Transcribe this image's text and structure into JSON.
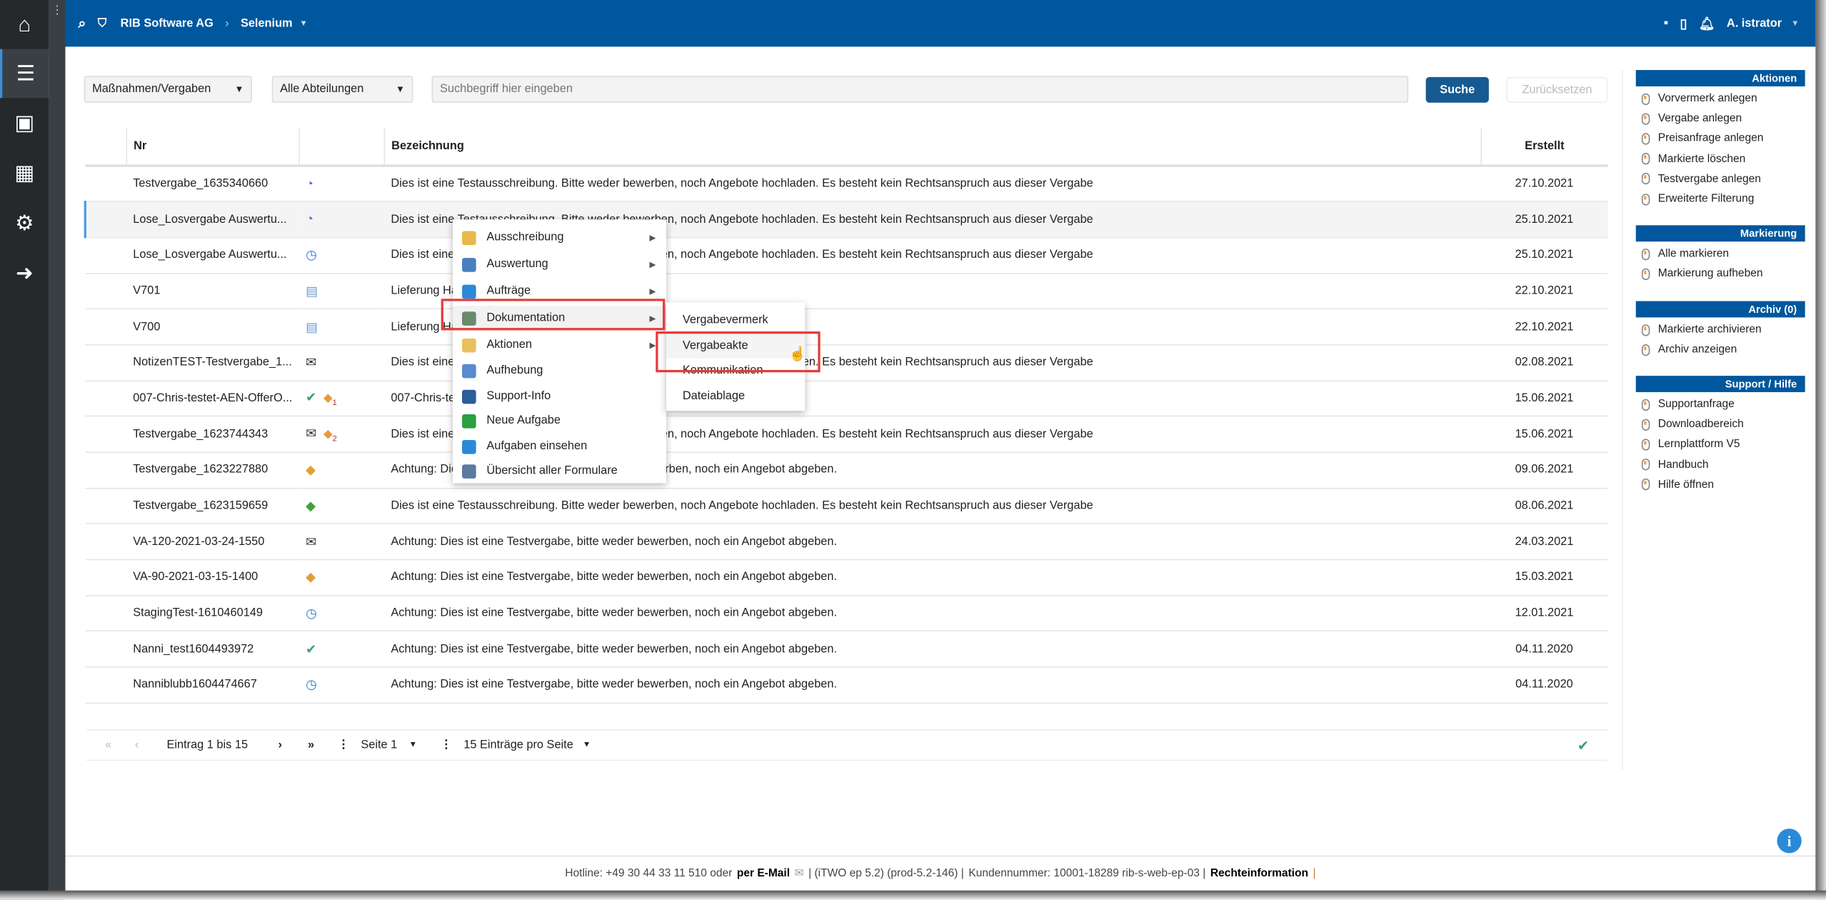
{
  "header": {
    "company": "RIB Software AG",
    "project": "Selenium",
    "user": "A. istrator"
  },
  "sidebar": {
    "items": [
      {
        "icon": "home-icon"
      },
      {
        "icon": "list-icon",
        "active": true
      },
      {
        "icon": "contacts-icon"
      },
      {
        "icon": "calendar-icon"
      },
      {
        "icon": "gear-icon"
      },
      {
        "icon": "logout-icon"
      }
    ]
  },
  "filters": {
    "type": "Maßnahmen/Vergaben",
    "department": "Alle Abteilungen",
    "search_placeholder": "Suchbegriff hier eingeben",
    "search_value": "",
    "search_label": "Suche",
    "reset_label": "Zurücksetzen"
  },
  "table": {
    "columns": [
      "Nr",
      "",
      "Bezeichnung",
      "Erstellt"
    ],
    "rows": [
      {
        "nr": "Testvergabe_1635340660",
        "icon": "chart-pie-icon",
        "text": "Dies ist eine Testausschreibung. Bitte weder bewerben, noch Angebote hochladen. Es besteht kein Rechtsanspruch aus dieser Vergabe",
        "date": "27.10.2021"
      },
      {
        "nr": "Lose_Losvergabe Auswertu...",
        "icon": "chart-pie-icon",
        "text": "Dies ist eine Testausschreibung. Bitte weder bewerben, noch Angebote hochladen. Es besteht kein Rechtsanspruch aus dieser Vergabe",
        "date": "25.10.2021"
      },
      {
        "nr": "Lose_Losvergabe Auswertu...",
        "icon": "clock-icon",
        "text": "Dies ist eine Testausschreibung. Bitte weder bewerben, noch Angebote hochladen. Es besteht kein Rechtsanspruch aus dieser Vergabe",
        "date": "25.10.2021"
      },
      {
        "nr": "V701",
        "icon": "edit-form-icon",
        "text": "Lieferung Ha",
        "date": "22.10.2021"
      },
      {
        "nr": "V700",
        "icon": "edit-form-icon",
        "text": "Lieferung Ha",
        "date": "22.10.2021"
      },
      {
        "nr": "NotizenTEST-Testvergabe_1...",
        "icon": "mail-icon",
        "text": "Dies ist eine Testausschreibung. Bitte weder bewerben, noch Angebote hochladen. Es besteht kein Rechtsanspruch aus dieser Vergabe",
        "date": "02.08.2021"
      },
      {
        "nr": "007-Chris-testet-AEN-OfferO...",
        "icon": "check-icon",
        "badge": "1",
        "text": "007-Chris-te",
        "date": "15.06.2021"
      },
      {
        "nr": "Testvergabe_1623744343",
        "icon": "mail-icon",
        "badge": "2",
        "text": "Dies ist eine Testausschreibung. Bitte weder bewerben, noch Angebote hochladen. Es besteht kein Rechtsanspruch aus dieser Vergabe",
        "date": "15.06.2021"
      },
      {
        "nr": "Testvergabe_1623227880",
        "icon": "package-icon",
        "text": "Achtung: Dies ist eine Testvergabe, bitte weder bewerben, noch ein Angebot abgeben.",
        "date": "09.06.2021"
      },
      {
        "nr": "Testvergabe_1623159659",
        "icon": "package-add-icon",
        "text": "Dies ist eine Testausschreibung. Bitte weder bewerben, noch Angebote hochladen. Es besteht kein Rechtsanspruch aus dieser Vergabe",
        "date": "08.06.2021"
      },
      {
        "nr": "VA-120-2021-03-24-1550",
        "icon": "mail-icon",
        "text": "Achtung: Dies ist eine Testvergabe, bitte weder bewerben, noch ein Angebot abgeben.",
        "date": "24.03.2021"
      },
      {
        "nr": "VA-90-2021-03-15-1400",
        "icon": "package-icon",
        "text": "Achtung: Dies ist eine Testvergabe, bitte weder bewerben, noch ein Angebot abgeben.",
        "date": "15.03.2021"
      },
      {
        "nr": "StagingTest-1610460149",
        "icon": "clock-icon",
        "text": "Achtung: Dies ist eine Testvergabe, bitte weder bewerben, noch ein Angebot abgeben.",
        "date": "12.01.2021"
      },
      {
        "nr": "Nanni_test1604493972",
        "icon": "check-icon",
        "text": "Achtung: Dies ist eine Testvergabe, bitte weder bewerben, noch ein Angebot abgeben.",
        "date": "04.11.2020"
      },
      {
        "nr": "Nanniblubb1604474667",
        "icon": "clock-icon",
        "text": "Achtung: Dies ist eine Testvergabe, bitte weder bewerben, noch ein Angebot abgeben.",
        "date": "04.11.2020"
      }
    ]
  },
  "pagination": {
    "range": "Eintrag 1 bis 15",
    "page": "Seite 1",
    "per_page": "15 Einträge pro Seite"
  },
  "context_menu": {
    "items": [
      {
        "label": "Ausschreibung",
        "submenu": true,
        "color": "#e8b84a"
      },
      {
        "label": "Auswertung",
        "submenu": true,
        "color": "#4a7fc0"
      },
      {
        "label": "Aufträge",
        "submenu": true,
        "color": "#2a8ad8"
      },
      {
        "label": "Dokumentation",
        "submenu": true,
        "color": "#6a8a6a",
        "highlighted": true
      },
      {
        "label": "Aktionen",
        "submenu": true,
        "color": "#e8c060"
      },
      {
        "label": "Aufhebung",
        "submenu": false,
        "color": "#5a8ad0"
      },
      {
        "label": "Support-Info",
        "submenu": false,
        "color": "#2b5c9c"
      },
      {
        "label": "Neue Aufgabe",
        "submenu": false,
        "color": "#2aa040"
      },
      {
        "label": "Aufgaben einsehen",
        "submenu": false,
        "color": "#2a8ad8"
      },
      {
        "label": "Übersicht aller Formulare",
        "submenu": false,
        "color": "#5a7aa0"
      }
    ]
  },
  "submenu": {
    "items": [
      {
        "label": "Vergabevermerk"
      },
      {
        "label": "Vergabeakte",
        "highlighted": true
      },
      {
        "label": "Kommunikation"
      },
      {
        "label": "Dateiablage"
      }
    ]
  },
  "right_panel": {
    "sections": [
      {
        "title": "Aktionen",
        "items": [
          "Vorvermerk anlegen",
          "Vergabe anlegen",
          "Preisanfrage anlegen",
          "Markierte löschen",
          "Testvergabe anlegen",
          "Erweiterte Filterung"
        ]
      },
      {
        "title": "Markierung",
        "items": [
          "Alle markieren",
          "Markierung aufheben"
        ]
      },
      {
        "title": "Archiv (0)",
        "items": [
          "Markierte archivieren",
          "Archiv anzeigen"
        ]
      },
      {
        "title": "Support / Hilfe",
        "items": [
          "Supportanfrage",
          "Downloadbereich",
          "Lernplattform V5",
          "Handbuch",
          "Hilfe öffnen"
        ]
      }
    ]
  },
  "footer": {
    "hotline": "Hotline: +49 30 44 33 11 510 oder",
    "email": "per E-Mail",
    "version": "| (iTWO ep 5.2) (prod-5.2-146) |",
    "customer": "Kundennummer: 10001-18289 rib-s-web-ep-03 |",
    "legal": "Rechteinformation",
    "sep": "|"
  },
  "colors": {
    "brand": "#00579d",
    "highlight_box": "#e53b3b",
    "sidebar": "#25292c"
  }
}
